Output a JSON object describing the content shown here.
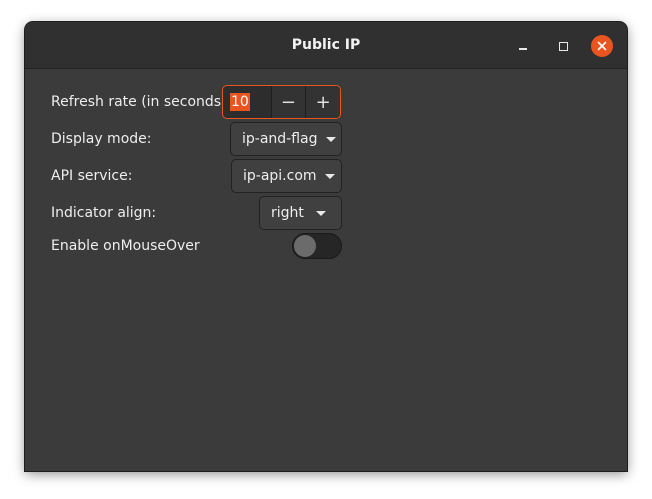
{
  "window": {
    "title": "Public IP",
    "controls": [
      "minimize-icon",
      "maximize-icon",
      "close-icon"
    ],
    "accent_color": "#e95420"
  },
  "settings": {
    "refresh_rate": {
      "label": "Refresh rate (in seconds)",
      "value": "10",
      "decrement": "−",
      "increment": "+"
    },
    "display_mode": {
      "label": "Display mode:",
      "selected": "ip-and-flag"
    },
    "api_service": {
      "label": "API service:",
      "selected": "ip-api.com"
    },
    "indicator_align": {
      "label": "Indicator align:",
      "selected": "right"
    },
    "mouseover": {
      "label": "Enable onMouseOver",
      "enabled": false
    }
  }
}
